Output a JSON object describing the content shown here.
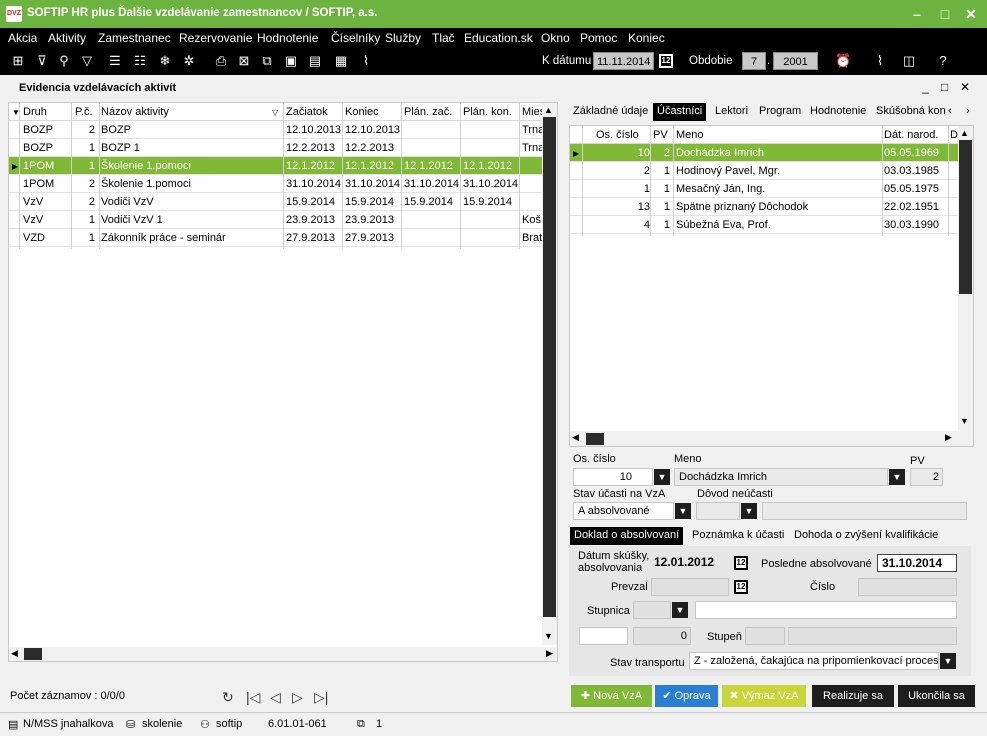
{
  "app": {
    "title": "SOFTIP HR plus Ďalšie vzdelávanie zamestnancov / SOFTIP, a.s.",
    "logo": "DVZ"
  },
  "menu": [
    "Akcia",
    "Aktivity",
    "Zamestnanec",
    "Rezervovanie",
    "Hodnotenie",
    "Číselníky",
    "Služby",
    "Tlač",
    "Education.sk",
    "Okno",
    "Pomoc",
    "Koniec"
  ],
  "toolbar": {
    "date_label": "K dátumu",
    "date_value": "11.11.2014",
    "period_label": "Obdobie",
    "period_month": "7",
    "period_year": "2001"
  },
  "left_panel": {
    "title": "Evidencia vzdelávacích aktivít",
    "columns": [
      "Druh",
      "P.č.",
      "Názov aktivity",
      "Začiatok",
      "Koniec",
      "Plán. zač.",
      "Plán. kon.",
      "Mies"
    ],
    "rows": [
      [
        "BOZP",
        "2",
        "BOZP",
        "12.10.2013",
        "12.10.2013",
        "",
        "",
        "Trna"
      ],
      [
        "BOZP",
        "1",
        "BOZP 1",
        "12.2.2013",
        "12.2.2013",
        "",
        "",
        "Trna"
      ],
      [
        "1POM",
        "1",
        "Školenie 1.pomoci",
        "12.1.2012",
        "12.1.2012",
        "12.1.2012",
        "12.1.2012",
        ""
      ],
      [
        "1POM",
        "2",
        "Školenie 1.pomoci",
        "31.10.2014",
        "31.10.2014",
        "31.10.2014",
        "31.10.2014",
        ""
      ],
      [
        "VzV",
        "2",
        "Vodiči VzV",
        "15.9.2014",
        "15.9.2014",
        "15.9.2014",
        "15.9.2014",
        ""
      ],
      [
        "VzV",
        "1",
        "Vodiči VzV 1",
        "23.9.2013",
        "23.9.2013",
        "",
        "",
        "Koš"
      ],
      [
        "VZD",
        "1",
        "Zákonník práce - seminár",
        "27.9.2013",
        "27.9.2013",
        "",
        "",
        "Brat"
      ]
    ],
    "selected_row": 2,
    "record_count": "Počet záznamov : 0/0/0"
  },
  "right_panel": {
    "tabs": [
      "Základné údaje",
      "Účastníci",
      "Lektori",
      "Program",
      "Hodnotenie",
      "Skúšobná kon"
    ],
    "active_tab": 1,
    "columns": [
      "Os. číslo",
      "PV",
      "Meno",
      "Dát. narod.",
      "D"
    ],
    "rows": [
      [
        "10",
        "2",
        "Dochádzka Imrich",
        "05.05.1969"
      ],
      [
        "2",
        "1",
        "Hodinový Pavel, Mgr.",
        "03.03.1985"
      ],
      [
        "1",
        "1",
        "Mesačný Ján, Ing.",
        "05.05.1975"
      ],
      [
        "13",
        "1",
        "Spätne priznaný Dôchodok",
        "22.02.1951"
      ],
      [
        "4",
        "1",
        "Súbežná Eva, Prof.",
        "30.03.1990"
      ]
    ],
    "selected_row": 0,
    "form": {
      "os_cislo_label": "Os. číslo",
      "os_cislo": "10",
      "meno_label": "Meno",
      "meno": "Dochádzka Imrich",
      "pv_label": "PV",
      "pv": "2",
      "stav_label": "Stav účasti na VzA",
      "stav": "A  absolvované",
      "dovod_label": "Dôvod neúčasti"
    },
    "subtabs": [
      "Doklad o absolvovaní",
      "Poznámka k účasti",
      "Dohoda o zvýšení kvalifikácie"
    ],
    "doklad": {
      "datum_label": "Dátum skúšky, absolvovania",
      "datum": "12.01.2012",
      "posledne_label": "Posledne absolvované",
      "posledne": "31.10.2014",
      "prevzal_label": "Prevzal",
      "cislo_label": "Číslo",
      "stupnica_label": "Stupnica",
      "stupen_label": "Stupeň",
      "zero": "0",
      "transport_label": "Stav transportu",
      "transport": "Z - založená, čakajúca na pripomienkovací proces"
    }
  },
  "buttons": {
    "nova": "Nová VzA",
    "oprava": "Oprava",
    "vymaz": "Výmaz VzA",
    "realizuje": "Realizuje sa",
    "ukoncila": "Ukončila sa"
  },
  "status": {
    "user": "N/MSS jnahalkova",
    "db": "skolenie",
    "login": "softip",
    "version": "6.01.01-061",
    "windows": "1"
  },
  "colors": {
    "green": "#7fb935",
    "title_green": "#6db33f",
    "blue": "#2a7fd4",
    "yellow": "#c8d63a"
  }
}
